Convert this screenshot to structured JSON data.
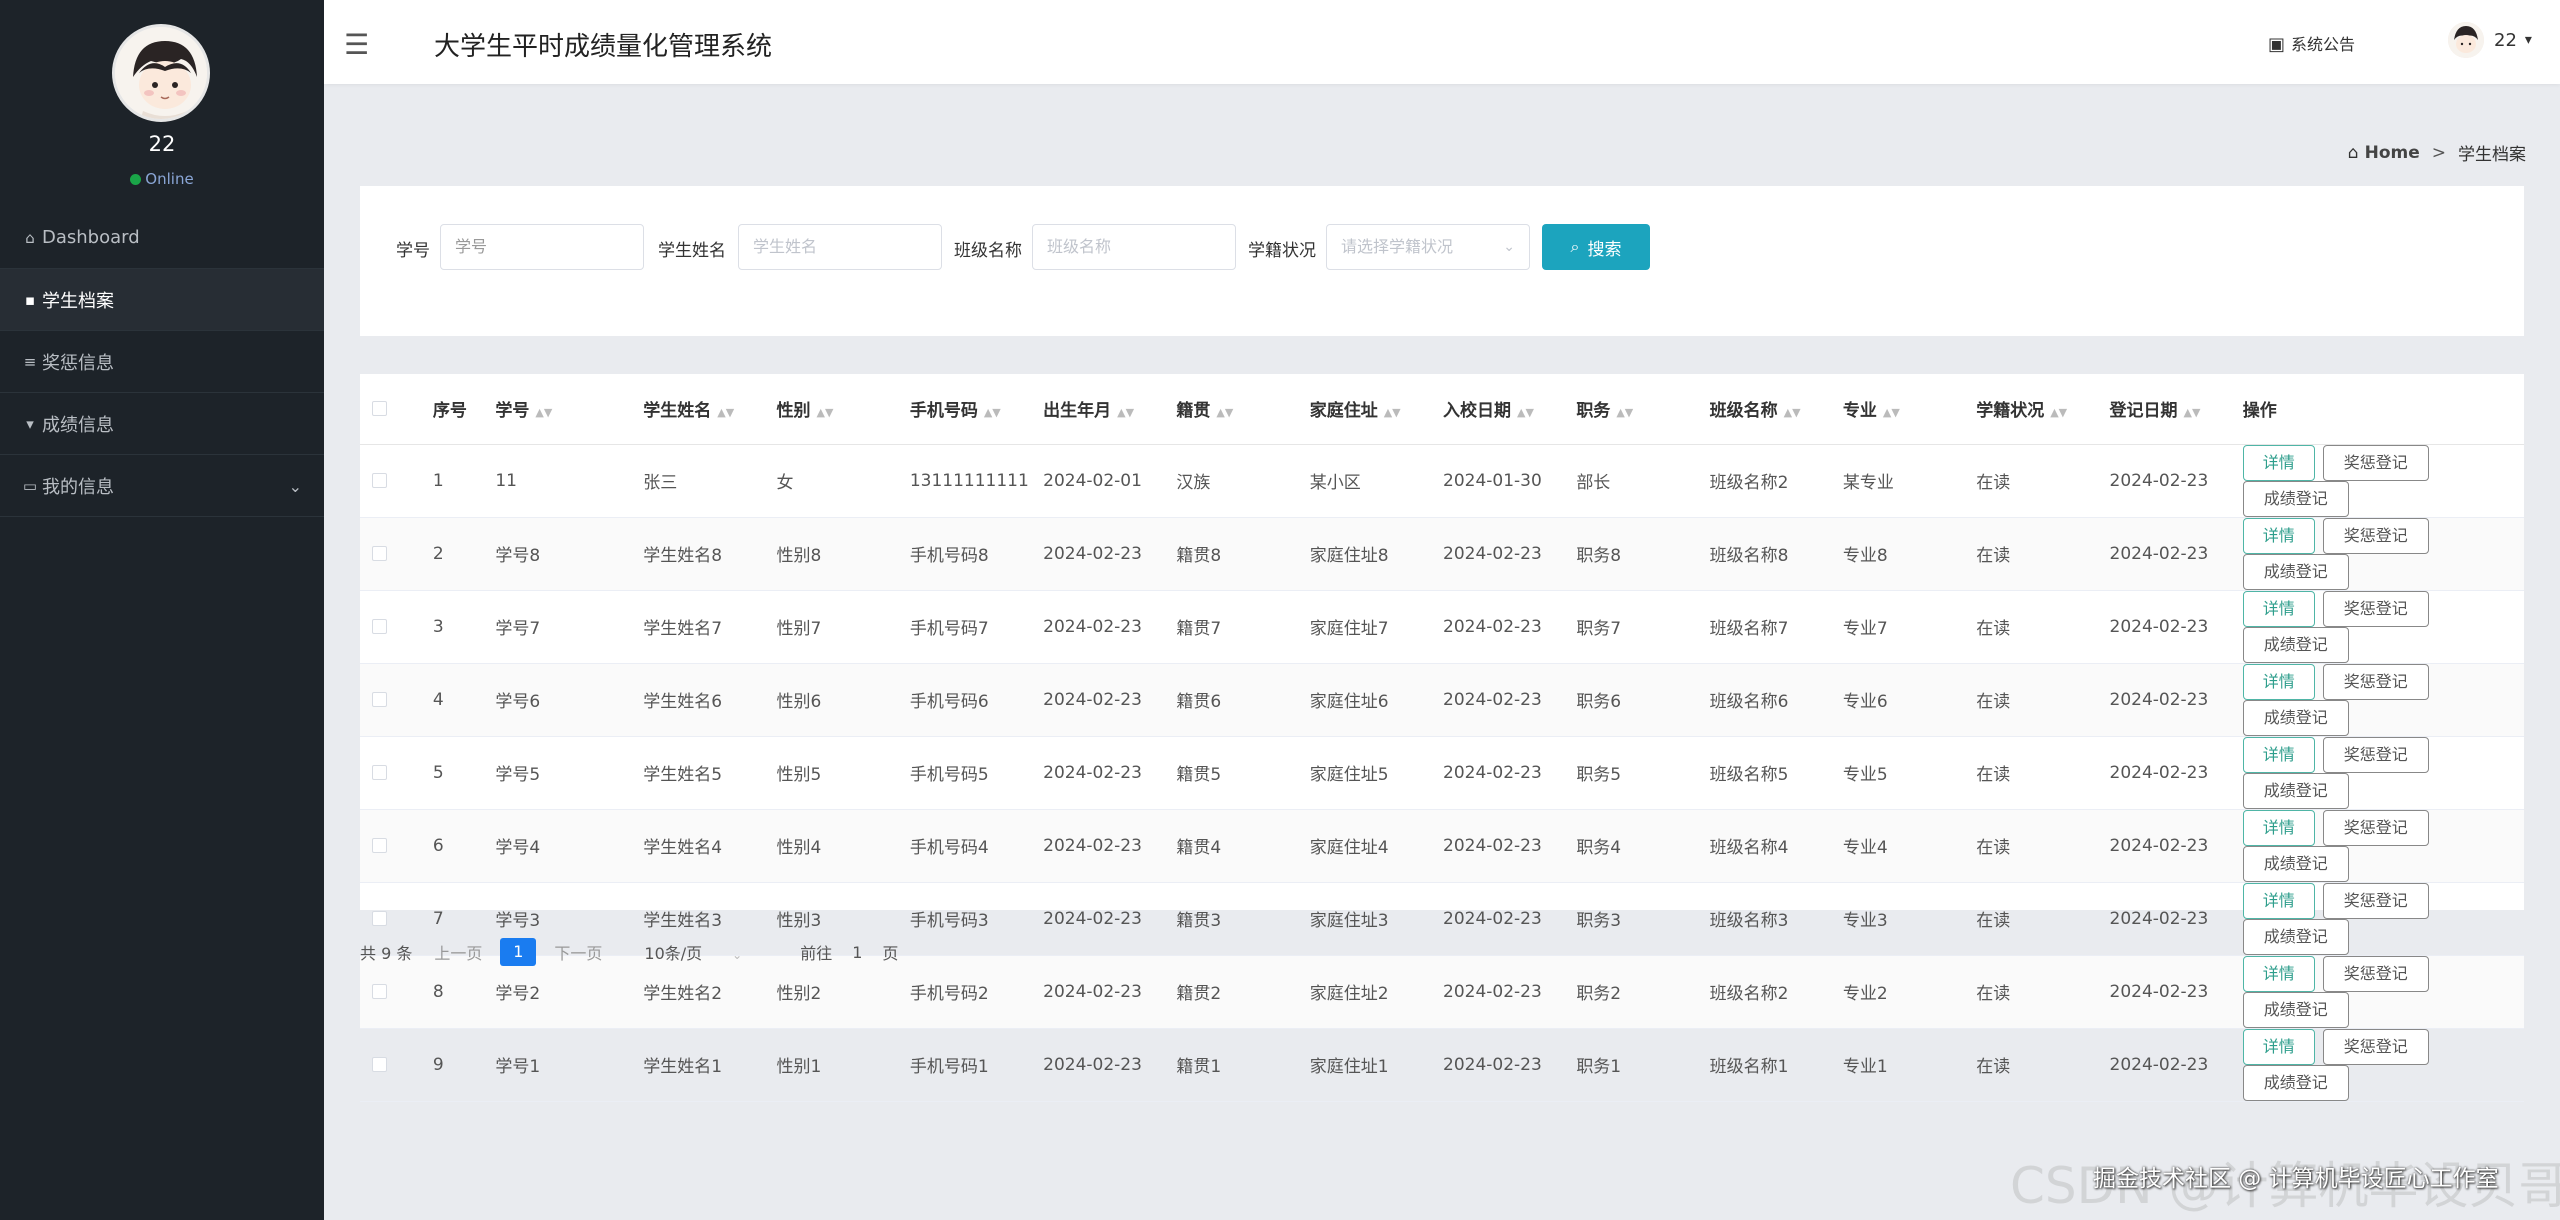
{
  "sidebar": {
    "username": "22",
    "status": "Online",
    "items": [
      {
        "label": "Dashboard"
      },
      {
        "label": "学生档案"
      },
      {
        "label": "奖惩信息"
      },
      {
        "label": "成绩信息"
      },
      {
        "label": "我的信息"
      }
    ]
  },
  "header": {
    "title": "大学生平时成绩量化管理系统",
    "notice": "系统公告",
    "user": "22"
  },
  "breadcrumb": {
    "home": "Home",
    "current": "学生档案"
  },
  "search": {
    "xuehao_label": "学号",
    "xuehao_placeholder": "学号",
    "name_label": "学生姓名",
    "name_placeholder": "学生姓名",
    "class_label": "班级名称",
    "class_placeholder": "班级名称",
    "status_label": "学籍状况",
    "status_placeholder": "请选择学籍状况",
    "button": "搜索"
  },
  "table": {
    "columns": [
      "序号",
      "学号",
      "学生姓名",
      "性别",
      "手机号码",
      "出生年月",
      "籍贯",
      "家庭住址",
      "入校日期",
      "职务",
      "班级名称",
      "专业",
      "学籍状况",
      "登记日期",
      "操作"
    ],
    "actions": {
      "detail": "详情",
      "award": "奖惩登记",
      "score": "成绩登记"
    },
    "rows": [
      [
        "1",
        "11",
        "张三",
        "女",
        "13111111111",
        "2024-02-01",
        "汉族",
        "某小区",
        "2024-01-30",
        "部长",
        "班级名称2",
        "某专业",
        "在读",
        "2024-02-23"
      ],
      [
        "2",
        "学号8",
        "学生姓名8",
        "性别8",
        "手机号码8",
        "2024-02-23",
        "籍贯8",
        "家庭住址8",
        "2024-02-23",
        "职务8",
        "班级名称8",
        "专业8",
        "在读",
        "2024-02-23"
      ],
      [
        "3",
        "学号7",
        "学生姓名7",
        "性别7",
        "手机号码7",
        "2024-02-23",
        "籍贯7",
        "家庭住址7",
        "2024-02-23",
        "职务7",
        "班级名称7",
        "专业7",
        "在读",
        "2024-02-23"
      ],
      [
        "4",
        "学号6",
        "学生姓名6",
        "性别6",
        "手机号码6",
        "2024-02-23",
        "籍贯6",
        "家庭住址6",
        "2024-02-23",
        "职务6",
        "班级名称6",
        "专业6",
        "在读",
        "2024-02-23"
      ],
      [
        "5",
        "学号5",
        "学生姓名5",
        "性别5",
        "手机号码5",
        "2024-02-23",
        "籍贯5",
        "家庭住址5",
        "2024-02-23",
        "职务5",
        "班级名称5",
        "专业5",
        "在读",
        "2024-02-23"
      ],
      [
        "6",
        "学号4",
        "学生姓名4",
        "性别4",
        "手机号码4",
        "2024-02-23",
        "籍贯4",
        "家庭住址4",
        "2024-02-23",
        "职务4",
        "班级名称4",
        "专业4",
        "在读",
        "2024-02-23"
      ],
      [
        "7",
        "学号3",
        "学生姓名3",
        "性别3",
        "手机号码3",
        "2024-02-23",
        "籍贯3",
        "家庭住址3",
        "2024-02-23",
        "职务3",
        "班级名称3",
        "专业3",
        "在读",
        "2024-02-23"
      ],
      [
        "8",
        "学号2",
        "学生姓名2",
        "性别2",
        "手机号码2",
        "2024-02-23",
        "籍贯2",
        "家庭住址2",
        "2024-02-23",
        "职务2",
        "班级名称2",
        "专业2",
        "在读",
        "2024-02-23"
      ],
      [
        "9",
        "学号1",
        "学生姓名1",
        "性别1",
        "手机号码1",
        "2024-02-23",
        "籍贯1",
        "家庭住址1",
        "2024-02-23",
        "职务1",
        "班级名称1",
        "专业1",
        "在读",
        "2024-02-23"
      ]
    ]
  },
  "pagination": {
    "total": "共 9 条",
    "prev": "上一页",
    "current": "1",
    "next": "下一页",
    "size": "10条/页",
    "goto": "前往",
    "goto_page": "1",
    "page_suffix": "页"
  },
  "watermark": {
    "big": "CSDN @计算机毕设贝哥",
    "small": "掘金技术社区 @ 计算机毕设匠心工作室"
  },
  "colors": {
    "sidebar_bg": "#1d2329",
    "accent": "#1ca4be",
    "pager_active": "#1a7cf0",
    "online": "#1aa548"
  }
}
